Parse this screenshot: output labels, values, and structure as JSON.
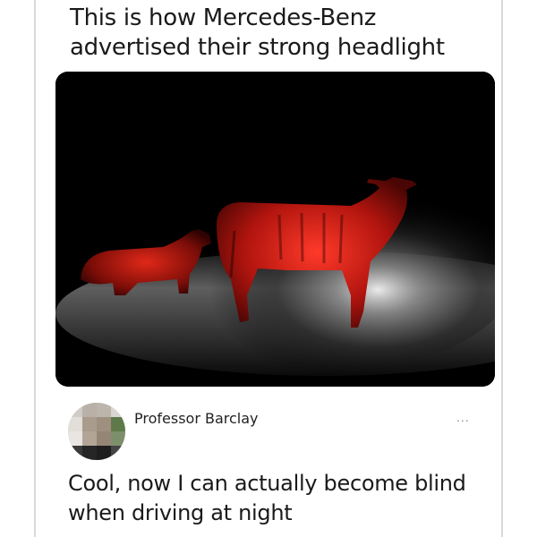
{
  "post": {
    "title": "This is how Mercedes-Benz advertised their strong headlight",
    "image_icon": "cows-headlight-photo"
  },
  "reply": {
    "username": "Professor Barclay",
    "more_label": "...",
    "text": "Cool, now I can actually become blind when driving at night",
    "avatar_icon": "pixelated-avatar"
  },
  "colors": {
    "background": "#ffffff",
    "text": "#1a1a1a",
    "muted": "#8a8a8a"
  }
}
